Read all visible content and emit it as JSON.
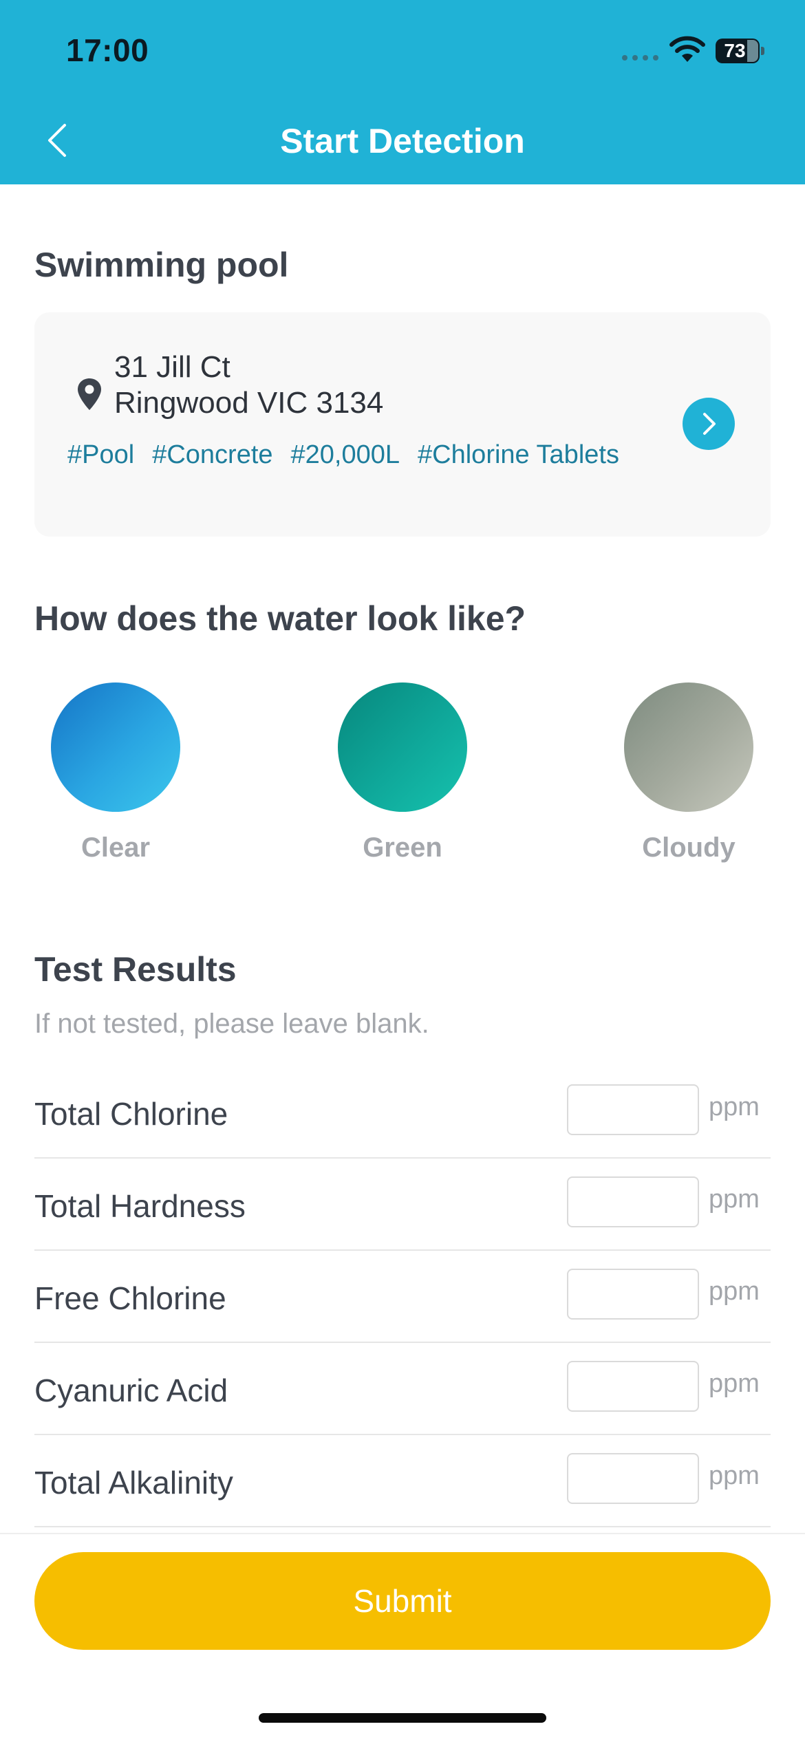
{
  "status_bar": {
    "time": "17:00",
    "battery": "73"
  },
  "header": {
    "title": "Start Detection",
    "back_icon": "chevron-left-icon"
  },
  "pool": {
    "section_title": "Swimming pool",
    "address_line1": "31 Jill Ct",
    "address_line2": "Ringwood VIC 3134",
    "tags": [
      "#Pool",
      "#Concrete",
      "#20,000L",
      "#Chlorine Tablets"
    ],
    "go_icon": "chevron-right-icon"
  },
  "water": {
    "section_title": "How does the water look like?",
    "options": [
      {
        "label": "Clear",
        "color": "#1f8fd6"
      },
      {
        "label": "Green",
        "color": "#0ea394"
      },
      {
        "label": "Cloudy",
        "color": "#a2a89c"
      }
    ]
  },
  "tests": {
    "section_title": "Test Results",
    "subtitle": "If not tested, please leave blank.",
    "rows": [
      {
        "label": "Total Chlorine",
        "value": "",
        "unit": "ppm"
      },
      {
        "label": "Total Hardness",
        "value": "",
        "unit": "ppm"
      },
      {
        "label": "Free Chlorine",
        "value": "",
        "unit": "ppm"
      },
      {
        "label": "Cyanuric Acid",
        "value": "",
        "unit": "ppm"
      },
      {
        "label": "Total Alkalinity",
        "value": "",
        "unit": "ppm"
      }
    ]
  },
  "submit": {
    "label": "Submit",
    "color": "#f6be00"
  },
  "colors": {
    "accent": "#20b2d6",
    "tag": "#1d7d9c"
  }
}
